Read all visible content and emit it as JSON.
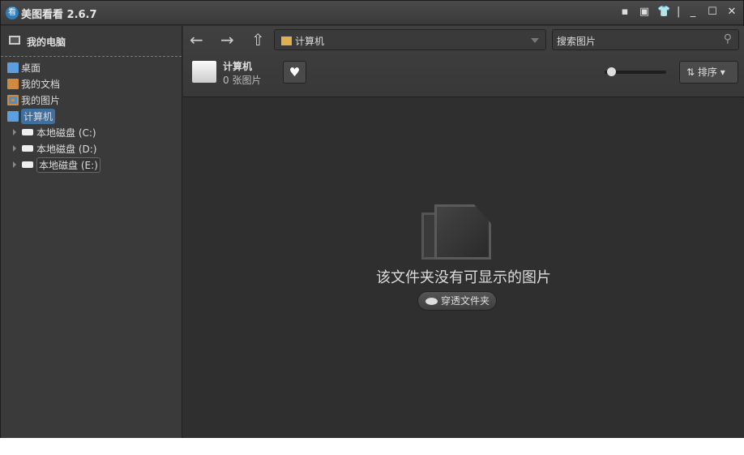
{
  "app": {
    "title": "美图看看 2.6.7",
    "logo": "看"
  },
  "window_buttons": [
    "message-icon",
    "menu-icon",
    "skin-icon",
    "minimize-icon",
    "maximize-icon",
    "close-icon"
  ],
  "sidebar": {
    "header": "我的电脑",
    "items": [
      {
        "label": "桌面"
      },
      {
        "label": "我的文档"
      },
      {
        "label": "我的图片"
      },
      {
        "label": "计算机"
      }
    ],
    "drives": [
      {
        "label": "本地磁盘 (C:)"
      },
      {
        "label": "本地磁盘 (D:)"
      },
      {
        "label": "本地磁盘 (E:)"
      }
    ]
  },
  "toolbar": {
    "back": "←",
    "forward": "→",
    "up": "⇧",
    "address": "计算机",
    "search_placeholder": "搜索图片",
    "sort_label": "排序"
  },
  "folder": {
    "name": "计算机",
    "count": "0 张图片"
  },
  "zoom_slider": {
    "value": 0.05
  },
  "content": {
    "empty_message": "该文件夹没有可显示的图片",
    "penetrate_button": "穿透文件夹"
  }
}
